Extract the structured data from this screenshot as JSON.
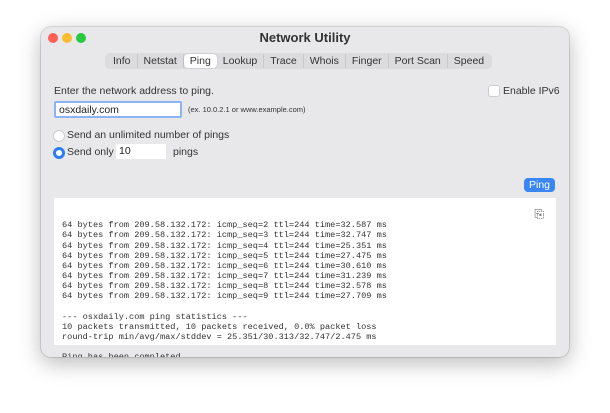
{
  "window": {
    "title": "Network Utility"
  },
  "tabs": [
    "Info",
    "Netstat",
    "Ping",
    "Lookup",
    "Trace",
    "Whois",
    "Finger",
    "Port Scan",
    "Speed"
  ],
  "selected_tab": "Ping",
  "form": {
    "prompt": "Enter the network address to ping.",
    "address": "osxdaily.com",
    "hint": "(ex. 10.0.2.1 or www.example.com)",
    "ipv6_label": "Enable IPv6",
    "ipv6_checked": false,
    "unlimited_label": "Send an unlimited number of pings",
    "send_only_label": "Send only",
    "count": "10",
    "pings_label": "pings",
    "selected_option": "send_only"
  },
  "ping_button": "Ping",
  "accent": "#3a86f7",
  "output": [
    "64 bytes from 209.58.132.172: icmp_seq=2 ttl=244 time=32.587 ms",
    "64 bytes from 209.58.132.172: icmp_seq=3 ttl=244 time=32.747 ms",
    "64 bytes from 209.58.132.172: icmp_seq=4 ttl=244 time=25.351 ms",
    "64 bytes from 209.58.132.172: icmp_seq=5 ttl=244 time=27.475 ms",
    "64 bytes from 209.58.132.172: icmp_seq=6 ttl=244 time=30.610 ms",
    "64 bytes from 209.58.132.172: icmp_seq=7 ttl=244 time=31.239 ms",
    "64 bytes from 209.58.132.172: icmp_seq=8 ttl=244 time=32.578 ms",
    "64 bytes from 209.58.132.172: icmp_seq=9 ttl=244 time=27.709 ms",
    "",
    "--- osxdaily.com ping statistics ---",
    "10 packets transmitted, 10 packets received, 0.0% packet loss",
    "round-trip min/avg/max/stddev = 25.351/30.313/32.747/2.475 ms",
    "",
    "Ping has been completed..."
  ]
}
